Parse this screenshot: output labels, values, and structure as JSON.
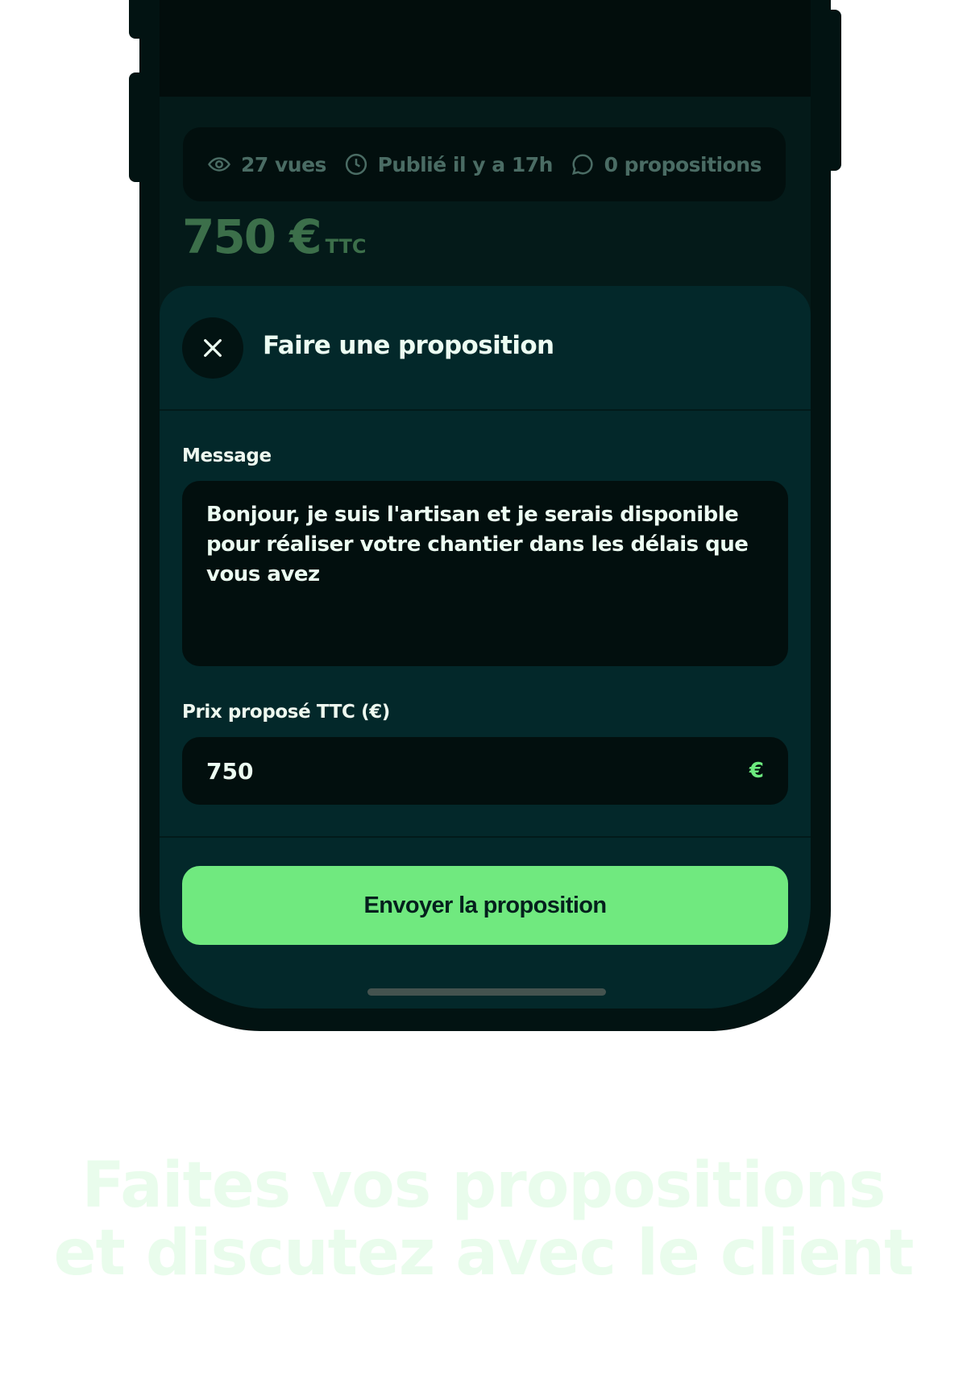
{
  "stats": {
    "views": "27 vues",
    "published": "Publié il y a 17h",
    "proposals": "0 propositions"
  },
  "listing": {
    "price": "750 €",
    "price_suffix": "TTC"
  },
  "sheet": {
    "title": "Faire une proposition",
    "message_label": "Message",
    "message_value": "Bonjour, je suis l'artisan et je serais disponible pour réaliser votre chantier dans les délais que vous avez",
    "price_label": "Prix proposé TTC (€)",
    "price_value": "750",
    "price_unit": "€",
    "submit_label": "Envoyer la proposition"
  },
  "headline": {
    "line1": "Faites vos propositions",
    "line2": "et discutez avec le client"
  },
  "colors": {
    "accent": "#70e97f",
    "background": "#03282a",
    "headline": "#e9fcec"
  }
}
